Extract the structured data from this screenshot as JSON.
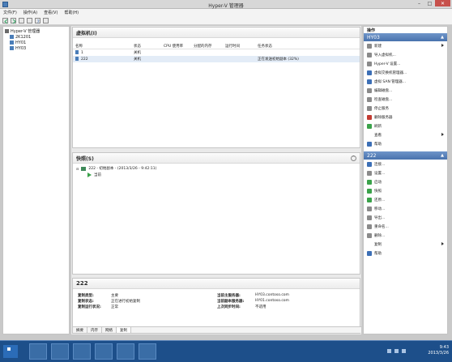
{
  "window": {
    "title": "Hyper-V 管理器"
  },
  "menu": [
    "文件(F)",
    "操作(A)",
    "查看(V)",
    "帮助(H)"
  ],
  "tree": {
    "root": "Hyper-V 管理器",
    "children": [
      "2K1201",
      "HY01",
      "HY03"
    ]
  },
  "vm_pane": {
    "title": "虚拟机(I)",
    "columns": [
      "名称",
      "状态",
      "CPU 使用率",
      "分配的内存",
      "运行时间",
      "任务状态"
    ],
    "rows": [
      [
        "1",
        "关机",
        "",
        "",
        "",
        ""
      ],
      [
        "222",
        "关机",
        "",
        "",
        "",
        "正在发送初始副本 (32%)"
      ]
    ]
  },
  "snap_pane": {
    "title": "快照(S)",
    "snapshot": "222 - 初始副本 - (2013/3/26 - 9:42:11)",
    "current": "当前"
  },
  "detail": {
    "title": "222",
    "left": [
      {
        "k": "复制类型:",
        "v": "主要"
      },
      {
        "k": "复制状态:",
        "v": "正在进行初始复制"
      },
      {
        "k": "复制运行状况:",
        "v": "正常"
      }
    ],
    "right": [
      {
        "k": "当前主服务器:",
        "v": "HY03.contoso.com"
      },
      {
        "k": "当前副本服务器:",
        "v": "HY01.contoso.com"
      },
      {
        "k": "上次同步时间:",
        "v": "不适用"
      }
    ],
    "tabs": [
      "摘要",
      "内存",
      "网络",
      "复制"
    ]
  },
  "actions": {
    "title": "操作",
    "group1": "HY03",
    "group1_items": [
      "新建",
      "导入虚拟机...",
      "Hyper-V 设置...",
      "虚拟交换机管理器...",
      "虚拟 SAN 管理器...",
      "编辑磁盘...",
      "检查磁盘...",
      "停止服务",
      "删除服务器",
      "刷新",
      "查看",
      "帮助"
    ],
    "group2": "222",
    "group2_items": [
      "连接...",
      "设置...",
      "启动",
      "快照",
      "还原...",
      "移动...",
      "导出...",
      "重命名...",
      "删除...",
      "复制",
      "帮助"
    ]
  },
  "taskbar": {
    "time": "9:43",
    "date": "2013/3/26"
  }
}
